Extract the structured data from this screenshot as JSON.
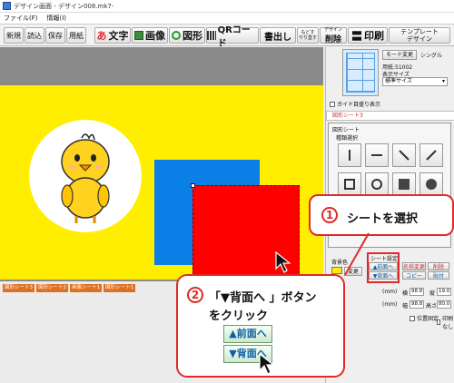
{
  "window": {
    "title": "デザイン画面 - デザイン008.mk7-",
    "menu": [
      "ファイル(F)",
      "情報(I)"
    ]
  },
  "toolbar": {
    "new": "新規",
    "open": "読込",
    "save": "保存",
    "paper": "用紙",
    "text": "文字",
    "image": "画像",
    "shape": "図形",
    "qrcode": "QRコード",
    "export": "書出し",
    "undo_redo": "もどす\nやり直す",
    "delete_top": "デザイン",
    "delete": "削除",
    "print": "印刷",
    "template": "テンプレート\nデザイン",
    "accent_text": "#e02a2a",
    "accent_shape": "#2a9a2a"
  },
  "right_panel": {
    "mode_change": "モード変更",
    "single": "シングル",
    "paper_label": "用紙:51002",
    "display_size_label": "表示サイズ",
    "display_size_value": "標準サイズ",
    "guide_checkbox": "ガイド目盛り表示",
    "sheet_title": "図形シート3",
    "shape_sheet": "図形シート",
    "shape_select": "種類選択",
    "bg_color": "背景色",
    "change": "変更",
    "sheet_settings": "シート設定",
    "front_btn": "▲前面へ",
    "back_btn": "▼背面へ",
    "rename": "名称変更",
    "copy": "コピー",
    "delete": "削除",
    "paste": "貼付",
    "size_mm": "(mm)",
    "width_label": "横",
    "width_value": "98.8",
    "height_label": "縦",
    "height_value": "19.0",
    "size2_mm": "(mm)",
    "w_label": "幅",
    "w_value": "98.8",
    "h_label": "高さ",
    "h_value": "80.0",
    "lock_pos": "位置固定",
    "no_print": "印刷なし"
  },
  "sheet_tabs": [
    {
      "label": "図形シート3",
      "color": "#e07020"
    },
    {
      "label": "図形シート2",
      "color": "#e07020"
    },
    {
      "label": "画像シート1",
      "color": "#e07020"
    },
    {
      "label": "図形シート1",
      "color": "#e07020"
    }
  ],
  "callout1": {
    "number": "1",
    "text": "シートを選択"
  },
  "callout2": {
    "number": "2",
    "line1": "「▼背面へ 」ボタン",
    "line2": "をクリック",
    "btn_front": "▲前面へ",
    "btn_back": "▼背面へ"
  },
  "colors": {
    "background_yellow": "#ffee00",
    "blue_square": "#0a7fe6",
    "red_square": "#ff0000",
    "callout_border": "#e02a2a"
  }
}
